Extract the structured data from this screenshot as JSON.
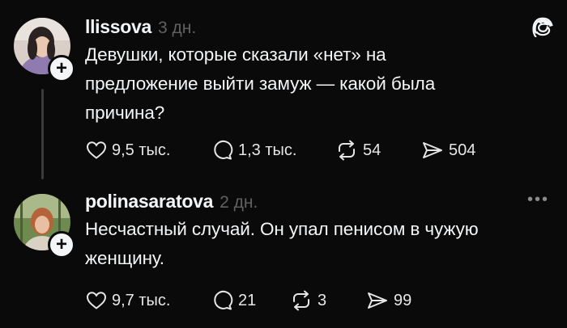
{
  "posts": [
    {
      "username": "llissova",
      "time": "3 дн.",
      "text": "Девушки, которые сказали «нет» на предложение выйти замуж — какой была причина?",
      "likes": "9,5 тыс.",
      "replies": "1,3 тыс.",
      "reposts": "54",
      "shares": "504"
    },
    {
      "username": "polinasaratova",
      "time": "2 дн.",
      "text": "Несчастный случай. Он упал пенисом в чужую женщину.",
      "likes": "9,7 тыс.",
      "replies": "21",
      "reposts": "3",
      "shares": "99"
    }
  ],
  "icons": {
    "like": "heart-icon",
    "reply": "comment-icon",
    "repost": "repost-icon",
    "share": "send-icon",
    "app": "threads-logo-icon",
    "more": "more-options-icon",
    "follow": "plus-icon"
  },
  "colors": {
    "background": "#0a0a0a",
    "text": "#f3f5f7",
    "muted": "#616161"
  }
}
